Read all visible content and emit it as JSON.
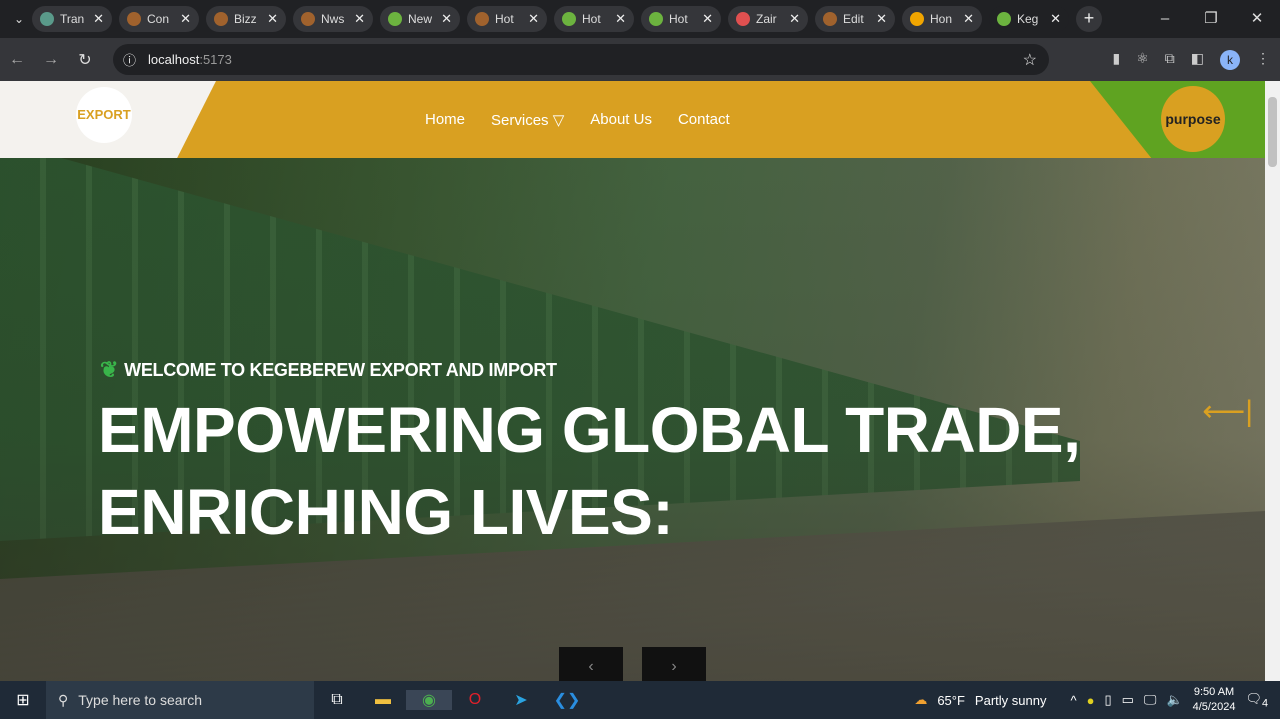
{
  "browser": {
    "tabs": [
      {
        "label": "Tran",
        "color": "#5a9a8a"
      },
      {
        "label": "Con",
        "color": "#a0622d"
      },
      {
        "label": "Bizz",
        "color": "#a0622d"
      },
      {
        "label": "Nws",
        "color": "#a0622d"
      },
      {
        "label": "New",
        "color": "#6cb33f"
      },
      {
        "label": "Hot",
        "color": "#a0622d"
      },
      {
        "label": "Hot",
        "color": "#6cb33f"
      },
      {
        "label": "Hot",
        "color": "#6cb33f"
      },
      {
        "label": "Zair",
        "color": "#e05050"
      },
      {
        "label": "Edit",
        "color": "#a0622d"
      },
      {
        "label": "Hon",
        "color": "#f0a500"
      },
      {
        "label": "Keg",
        "color": "#6cb33f"
      }
    ],
    "url_host": "localhost",
    "url_port": ":5173",
    "profile": "k"
  },
  "site": {
    "logo": "EXPORT",
    "partner_logo": "purpose",
    "menu": [
      "Home",
      "Services",
      "About Us",
      "Contact"
    ],
    "welcome": "WELCOME TO KEGEBEREW EXPORT AND IMPORT",
    "title_line1": "EMPOWERING GLOBAL TRADE,",
    "title_line2": "ENRICHING LIVES:"
  },
  "taskbar": {
    "search_placeholder": "Type here to search",
    "weather_temp": "65°F",
    "weather_text": "Partly sunny",
    "time": "9:50 AM",
    "date": "4/5/2024",
    "notifications": "4"
  }
}
